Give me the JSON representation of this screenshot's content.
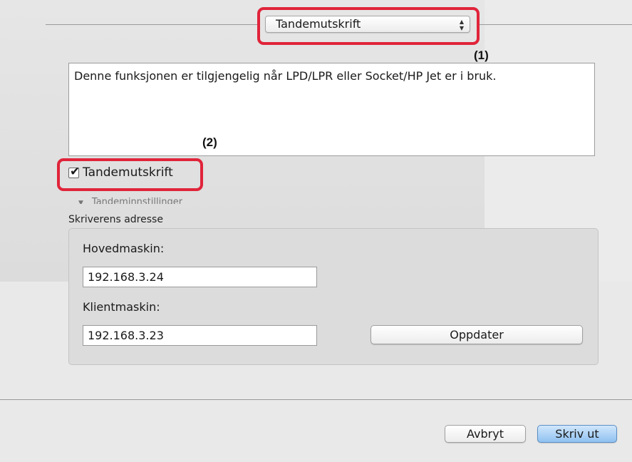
{
  "print_dialog": {
    "section_popup": {
      "selected": "Tandemutskrift",
      "arrow_up": "▲",
      "arrow_down": "▼"
    },
    "callouts": {
      "popup": "(1)",
      "checkbox": "(2)"
    },
    "info_text": "Denne funksjonen er tilgjengelig når LPD/LPR eller Socket/HP Jet er i bruk.",
    "tandem_checkbox": {
      "label": "Tandemutskrift",
      "checked": true,
      "mark": "✔"
    },
    "disclosure": {
      "triangle": "▼",
      "label": "Tandeminnstillinger"
    },
    "printer_address": {
      "title": "Skriverens adresse",
      "master_label": "Hovedmaskin:",
      "master_value": "192.168.3.24",
      "client_label": "Klientmaskin:",
      "client_value": "192.168.3.23",
      "update_button": "Oppdater"
    },
    "footer": {
      "cancel_button": "Avbryt",
      "print_button": "Skriv ut"
    },
    "colors": {
      "callout_red": "#e0243a",
      "default_button_blue": "#8fc1f1"
    }
  }
}
